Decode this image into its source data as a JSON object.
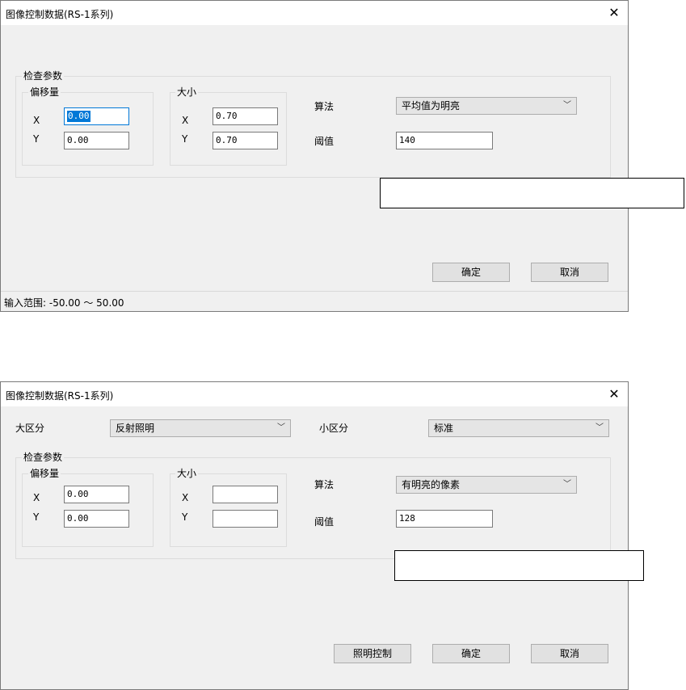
{
  "dialog1": {
    "title": "图像控制数据(RS-1系列)",
    "close_glyph": "✕",
    "inspect_group": "检查参数",
    "offset_group": "偏移量",
    "size_group": "大小",
    "x_label": "X",
    "y_label": "Y",
    "offset_x": "0.00",
    "offset_y": "0.00",
    "size_x": "0.70",
    "size_y": "0.70",
    "algorithm_label": "算法",
    "algorithm_value": "平均值为明亮",
    "threshold_label": "阈值",
    "threshold_value": "140",
    "ok_button": "确定",
    "cancel_button": "取消",
    "status_text": "输入范围: -50.00 ～ 50.00"
  },
  "dialog2": {
    "title": "图像控制数据(RS-1系列)",
    "close_glyph": "✕",
    "major_label": "大区分",
    "major_value": "反射照明",
    "minor_label": "小区分",
    "minor_value": "标准",
    "inspect_group": "检查参数",
    "offset_group": "偏移量",
    "size_group": "大小",
    "x_label": "X",
    "y_label": "Y",
    "offset_x": "0.00",
    "offset_y": "0.00",
    "size_x": "",
    "size_y": "",
    "algorithm_label": "算法",
    "algorithm_value": "有明亮的像素",
    "threshold_label": "阈值",
    "threshold_value": "128",
    "lighting_button": "照明控制",
    "ok_button": "确定",
    "cancel_button": "取消"
  },
  "icons": {
    "chevron": "﹀"
  }
}
